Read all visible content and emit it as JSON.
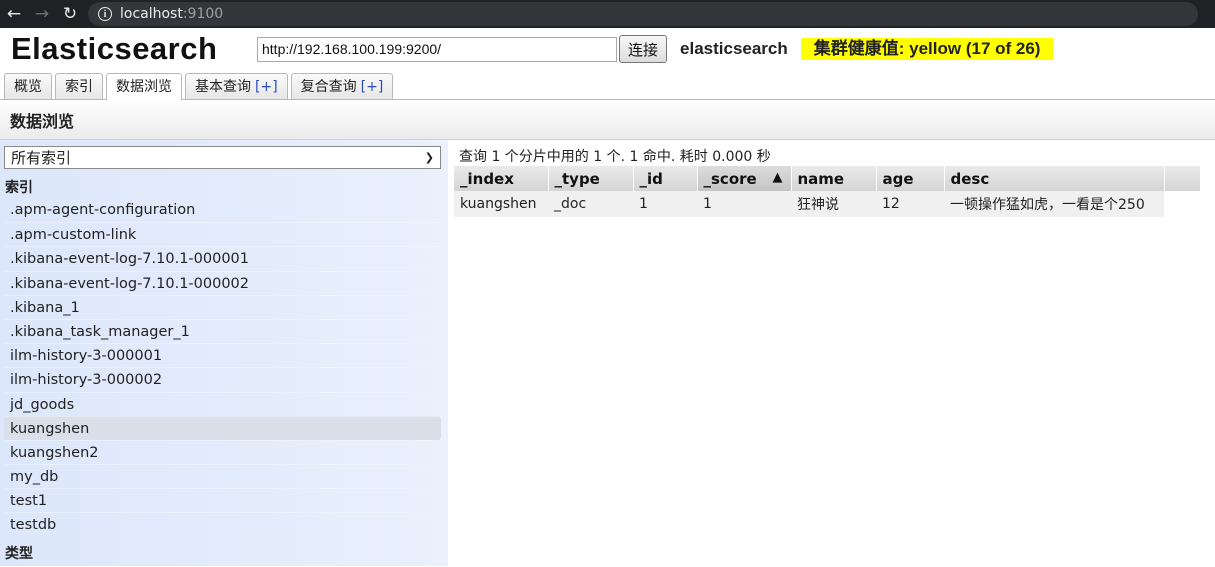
{
  "browser": {
    "host": "localhost",
    "port": ":9100"
  },
  "header": {
    "title": "Elasticsearch",
    "cluster_url": "http://192.168.100.199:9200/",
    "connect_label": "连接",
    "cluster_name": "elasticsearch",
    "health": "集群健康值: yellow (17 of 26)",
    "health_color": "#ffff00"
  },
  "tabs": [
    {
      "label": "概览"
    },
    {
      "label": "索引"
    },
    {
      "label": "数据浏览"
    },
    {
      "label": "基本查询",
      "plus": "[+]"
    },
    {
      "label": "复合查询",
      "plus": "[+]"
    }
  ],
  "section_title": "数据浏览",
  "sidebar": {
    "index_select": "所有索引",
    "indices_title": "索引",
    "indices": [
      ".apm-agent-configuration",
      ".apm-custom-link",
      ".kibana-event-log-7.10.1-000001",
      ".kibana-event-log-7.10.1-000002",
      ".kibana_1",
      ".kibana_task_manager_1",
      "ilm-history-3-000001",
      "ilm-history-3-000002",
      "jd_goods",
      "kuangshen",
      "kuangshen2",
      "my_db",
      "test1",
      "testdb"
    ],
    "selected_index": "kuangshen",
    "types_title": "类型"
  },
  "results": {
    "query_info": "查询 1 个分片中用的 1 个. 1 命中. 耗时 0.000 秒",
    "columns": [
      "_index",
      "_type",
      "_id",
      "_score",
      "name",
      "age",
      "desc"
    ],
    "sort_arrow": "▲",
    "rows": [
      [
        "kuangshen",
        "_doc",
        "1",
        "1",
        "狂神说",
        "12",
        "一顿操作猛如虎，一看是个250"
      ]
    ]
  }
}
